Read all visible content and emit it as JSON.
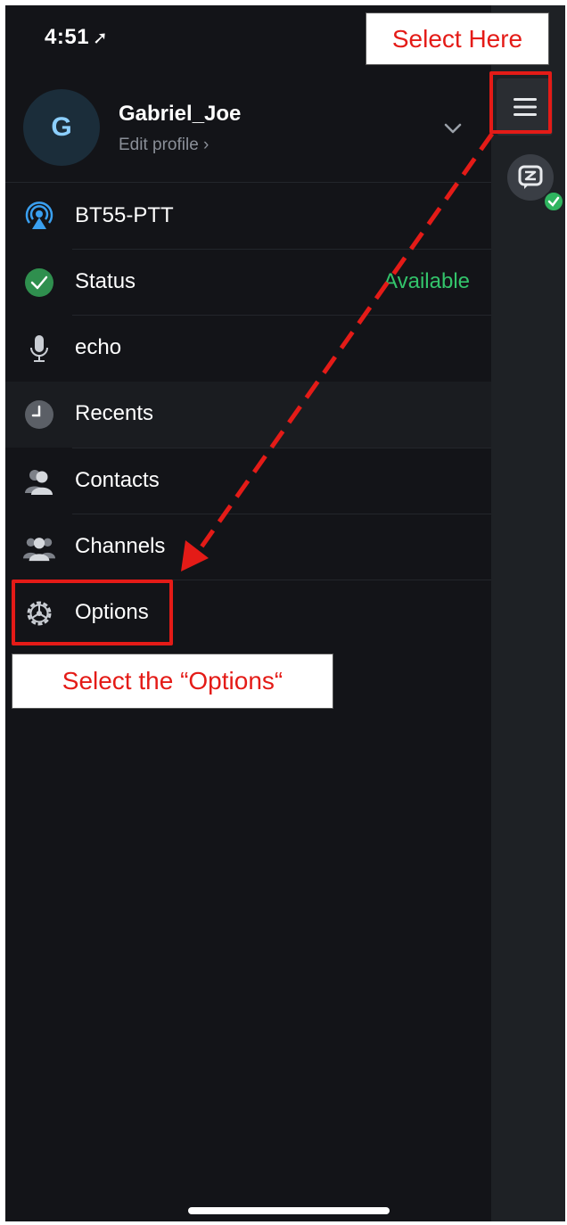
{
  "status_bar": {
    "time": "4:51",
    "location_glyph": "➚"
  },
  "profile": {
    "initial": "G",
    "name": "Gabriel_Joe",
    "edit_label": "Edit profile ›"
  },
  "menu": [
    {
      "label": "BT55-PTT",
      "icon": "broadcast-icon"
    },
    {
      "label": "Status",
      "value": "Available",
      "icon": "check-circle-icon"
    },
    {
      "label": "echo",
      "icon": "microphone-icon"
    },
    {
      "label": "Recents",
      "icon": "clock-icon"
    },
    {
      "label": "Contacts",
      "icon": "contacts-icon"
    },
    {
      "label": "Channels",
      "icon": "channels-icon"
    },
    {
      "label": "Options",
      "icon": "gear-icon"
    }
  ],
  "annotations": {
    "select_here": "Select Here",
    "select_options": "Select the “Options“"
  },
  "colors": {
    "accent_green": "#33c46b",
    "annotation_red": "#e41b17",
    "avatar_text": "#8ccfff"
  }
}
